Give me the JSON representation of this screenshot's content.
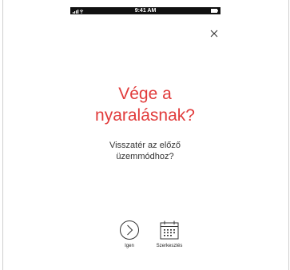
{
  "status_bar": {
    "time": "9:41 AM"
  },
  "dialog": {
    "title_line1": "Vége a",
    "title_line2": "nyaralásnak?",
    "message_line1": "Visszatér az előző",
    "message_line2": "üzemmódhoz?"
  },
  "actions": {
    "yes_label": "Igen",
    "edit_label": "Szerkesztés"
  },
  "icons": {
    "close": "close-icon",
    "yes": "chevron-right-circle-icon",
    "edit": "calendar-icon"
  },
  "colors": {
    "accent": "#e13b3b",
    "text": "#333333"
  }
}
